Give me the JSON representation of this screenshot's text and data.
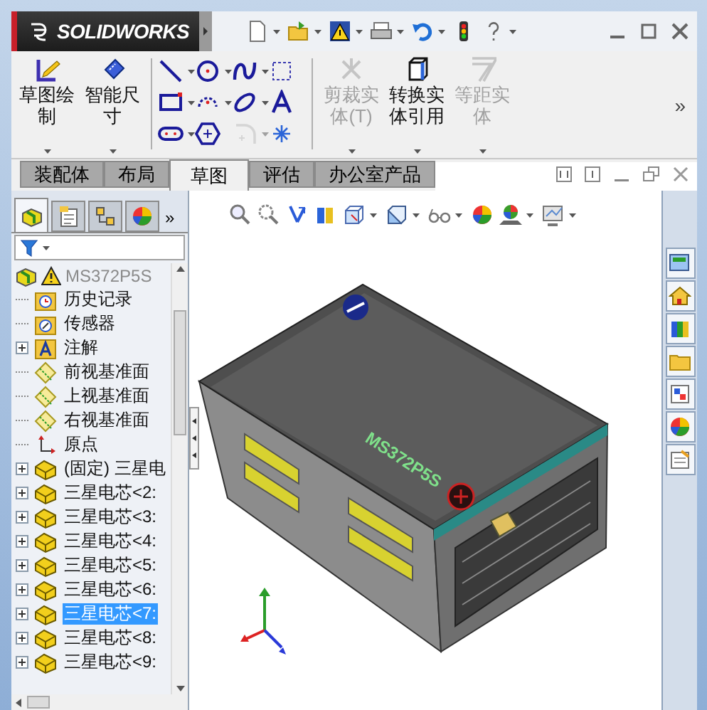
{
  "title_bar": {
    "logo": "SOLIDWORKS",
    "quick_access": [
      {
        "kind": "new",
        "dropdown": true
      },
      {
        "kind": "open",
        "dropdown": true
      },
      {
        "kind": "save",
        "dropdown": true
      },
      {
        "kind": "print",
        "dropdown": true
      },
      {
        "kind": "undo",
        "dropdown": true
      },
      {
        "kind": "rebuild",
        "dropdown": false
      },
      {
        "kind": "help",
        "dropdown": true
      }
    ]
  },
  "ribbon": {
    "sketch_buttons": [
      {
        "label": "草图绘制",
        "kind": "sketch",
        "disabled": false
      },
      {
        "label": "智能尺寸",
        "kind": "dimension",
        "disabled": false
      }
    ],
    "tools": [
      {
        "kind": "line",
        "dropdown": true,
        "disabled": false
      },
      {
        "kind": "circle",
        "dropdown": true,
        "disabled": false
      },
      {
        "kind": "spline",
        "dropdown": true,
        "disabled": false
      },
      {
        "kind": "construction",
        "dropdown": false,
        "disabled": false
      },
      {
        "kind": "rectangle",
        "dropdown": true,
        "disabled": false
      },
      {
        "kind": "arc",
        "dropdown": true,
        "disabled": false
      },
      {
        "kind": "ellipse",
        "dropdown": true,
        "disabled": false
      },
      {
        "kind": "text",
        "dropdown": false,
        "disabled": false
      },
      {
        "kind": "slot",
        "dropdown": true,
        "disabled": false
      },
      {
        "kind": "polygon",
        "dropdown": false,
        "disabled": false
      },
      {
        "kind": "fillet",
        "dropdown": true,
        "disabled": true
      },
      {
        "kind": "point",
        "dropdown": false,
        "disabled": false
      }
    ],
    "entity_buttons": [
      {
        "label": "剪裁实体(T)",
        "kind": "trim",
        "disabled": true
      },
      {
        "label": "转换实体引用",
        "kind": "convert",
        "disabled": false
      },
      {
        "label": "等距实体",
        "kind": "offset",
        "disabled": true
      }
    ],
    "more": "»"
  },
  "tabs": [
    {
      "label": "装配体",
      "selected": false
    },
    {
      "label": "布局",
      "selected": false
    },
    {
      "label": "草图",
      "selected": true
    },
    {
      "label": "评估",
      "selected": false
    },
    {
      "label": "办公室产品",
      "selected": false
    }
  ],
  "panel": {
    "tabs": [
      {
        "kind": "feature-tree",
        "selected": true
      },
      {
        "kind": "properties",
        "selected": false
      },
      {
        "kind": "configurations",
        "selected": false
      },
      {
        "kind": "appearance",
        "selected": false
      }
    ],
    "more": "»",
    "root": {
      "label": "MS372P5S",
      "warning": true
    },
    "items": [
      {
        "label": "历史记录",
        "kind": "history",
        "expandable": false,
        "selected": false
      },
      {
        "label": "传感器",
        "kind": "sensor",
        "expandable": false,
        "selected": false
      },
      {
        "label": "注解",
        "kind": "annotation",
        "expandable": true,
        "selected": false
      },
      {
        "label": "前视基准面",
        "kind": "plane",
        "expandable": false,
        "selected": false
      },
      {
        "label": "上视基准面",
        "kind": "plane",
        "expandable": false,
        "selected": false
      },
      {
        "label": "右视基准面",
        "kind": "plane",
        "expandable": false,
        "selected": false
      },
      {
        "label": "原点",
        "kind": "origin",
        "expandable": false,
        "selected": false
      },
      {
        "label": "(固定) 三星电",
        "kind": "part",
        "expandable": true,
        "selected": false
      },
      {
        "label": "三星电芯<2:",
        "kind": "part",
        "expandable": true,
        "selected": false
      },
      {
        "label": "三星电芯<3:",
        "kind": "part",
        "expandable": true,
        "selected": false
      },
      {
        "label": "三星电芯<4:",
        "kind": "part",
        "expandable": true,
        "selected": false
      },
      {
        "label": "三星电芯<5:",
        "kind": "part",
        "expandable": true,
        "selected": false
      },
      {
        "label": "三星电芯<6:",
        "kind": "part",
        "expandable": true,
        "selected": false
      },
      {
        "label": "三星电芯<7:",
        "kind": "part",
        "expandable": true,
        "selected": true
      },
      {
        "label": "三星电芯<8:",
        "kind": "part",
        "expandable": true,
        "selected": false
      },
      {
        "label": "三星电芯<9:",
        "kind": "part",
        "expandable": true,
        "selected": false
      }
    ]
  },
  "viewport": {
    "toolbar": [
      {
        "kind": "zoom-fit",
        "dropdown": false
      },
      {
        "kind": "zoom-area",
        "dropdown": false
      },
      {
        "kind": "previous-view",
        "dropdown": false
      },
      {
        "kind": "section",
        "dropdown": false
      },
      {
        "kind": "orientation",
        "dropdown": true
      },
      {
        "kind": "display-style",
        "dropdown": true
      },
      {
        "kind": "hide-show",
        "dropdown": true
      },
      {
        "kind": "appearance",
        "dropdown": false
      },
      {
        "kind": "scene",
        "dropdown": true
      },
      {
        "kind": "display-settings",
        "dropdown": true
      }
    ],
    "model_label": "MS372P5S"
  },
  "task_pane": [
    {
      "kind": "resources"
    },
    {
      "kind": "home"
    },
    {
      "kind": "library"
    },
    {
      "kind": "explorer"
    },
    {
      "kind": "palette"
    },
    {
      "kind": "appearance"
    },
    {
      "kind": "custom-properties"
    }
  ]
}
